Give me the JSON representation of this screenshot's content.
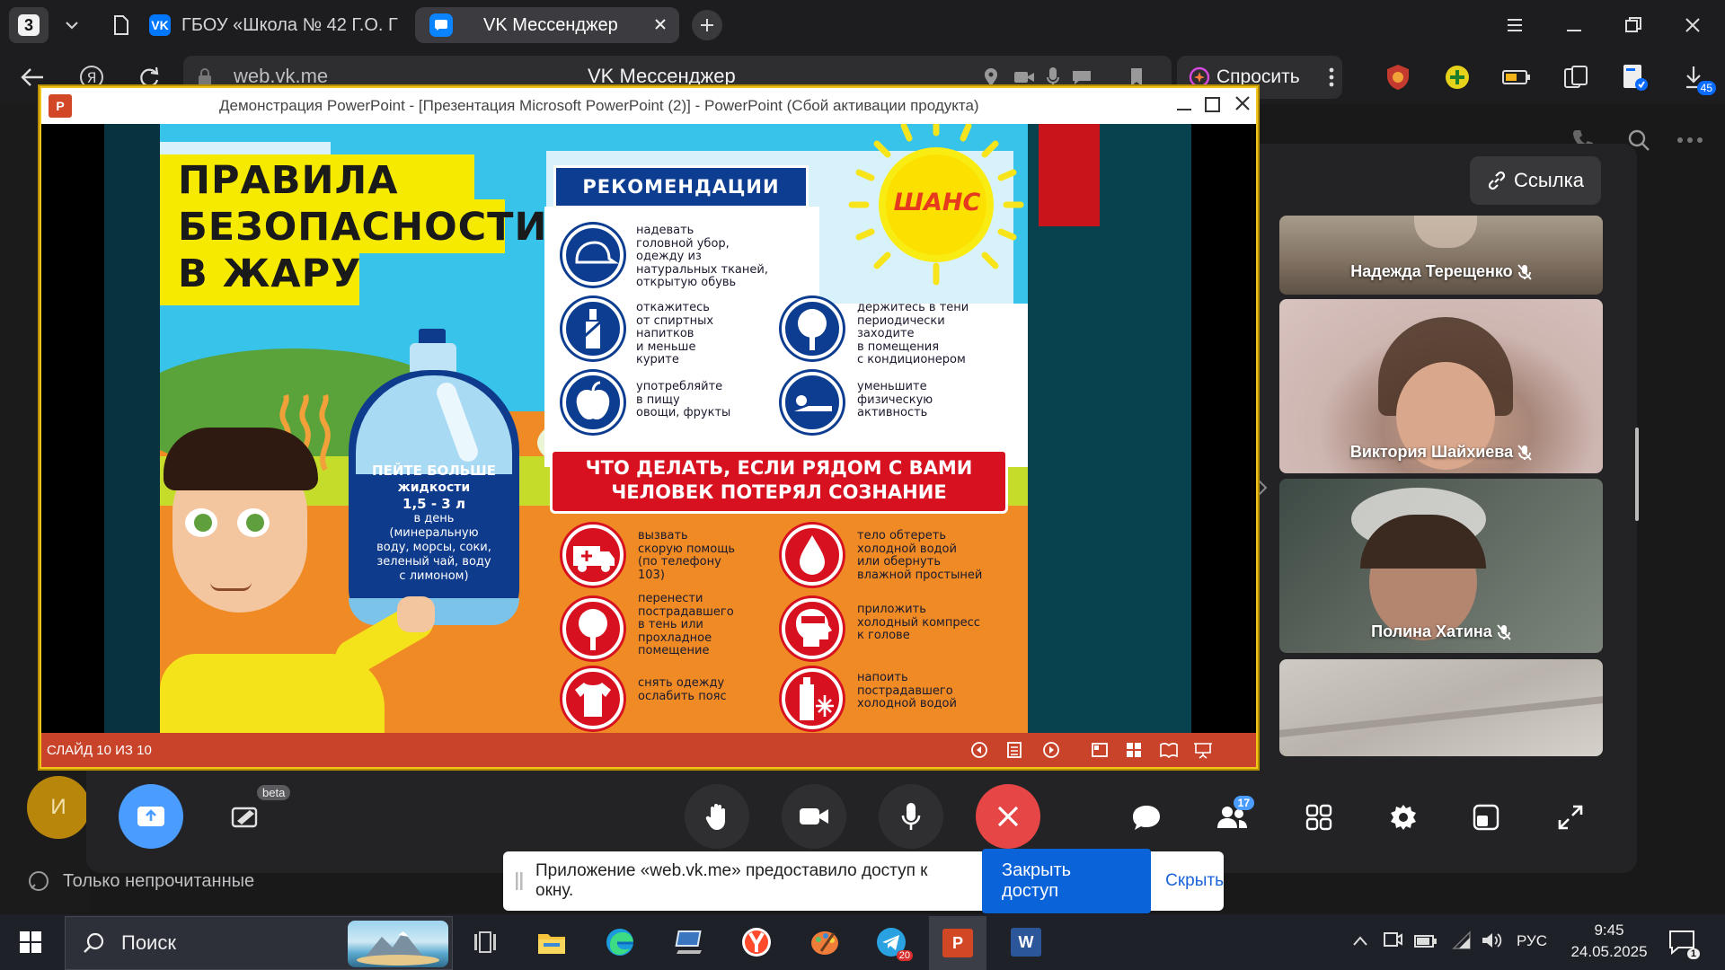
{
  "browser": {
    "tab_count": "3",
    "tabs": [
      {
        "title": "ГБОУ «Школа № 42 Г.О. Г",
        "active": false
      },
      {
        "title": "VK Мессенджер",
        "active": true
      }
    ],
    "address": "web.vk.me",
    "page_title": "VK Мессенджер",
    "ask_label": "Спросить",
    "downloads_badge": "45"
  },
  "vk": {
    "link_button": "Ссылка",
    "avatar_letter": "И",
    "filter_label": "Только непрочитанные",
    "participants_badge": "17",
    "beta_label": "beta"
  },
  "ppt": {
    "window_title": "Демонстрация PowerPoint - [Презентация Microsoft PowerPoint (2)] - PowerPoint (Сбой активации продукта)",
    "status": "СЛАЙД 10 ИЗ 10"
  },
  "slide": {
    "title_lines": [
      "ПРАВИЛА",
      "БЕЗОПАСНОСТИ",
      "В ЖАРУ"
    ],
    "logo": "ШАНС",
    "bottle_text": [
      "ПЕЙТЕ БОЛЬШЕ",
      "жидкости",
      "1,5 - 3 л",
      "в день",
      "(минеральную",
      "воду, морсы, соки,",
      "зеленый чай, воду",
      "с лимоном)"
    ],
    "rec_header": "РЕКОМЕНДАЦИИ",
    "recs_left": [
      "надевать\nголовной убор,\nодежду из\nнатуральных тканей,\nоткрытую обувь",
      "откажитесь\nот спиртных\nнапитков\nи меньше\nкурите",
      "употребляйте\nв пищу\nовощи, фрукты"
    ],
    "recs_right": [
      "держитесь в тени\nпериодически\nзаходите\nв помещения\nс кондиционером",
      "уменьшите\nфизическую\nактивность"
    ],
    "help_header_1": "ЧТО ДЕЛАТЬ, ЕСЛИ РЯДОМ С ВАМИ",
    "help_header_2": "ЧЕЛОВЕК ПОТЕРЯЛ СОЗНАНИЕ",
    "help_left": [
      "вызвать\nскорую помощь\n(по телефону\n103)",
      "перенести\nпострадавшего\nв тень или\nпрохладное\nпомещение",
      "снять одежду\nослабить пояс"
    ],
    "help_right": [
      "тело обтереть\nхолодной водой\nили обернуть\nвлажной простыней",
      "приложить\nхолодный компресс\nк голове",
      "напоить\nпострадавшего\nхолодной водой"
    ]
  },
  "participants": [
    {
      "name": "Надежда Терещенко"
    },
    {
      "name": "Виктория Шайхиева"
    },
    {
      "name": "Полина Хатина"
    }
  ],
  "share": {
    "message": "Приложение «web.vk.me» предоставило доступ к окну.",
    "stop_button": "Закрыть доступ",
    "hide_button": "Скрыть"
  },
  "taskbar": {
    "search": "Поиск",
    "lang": "РУС",
    "time": "9:45",
    "date": "24.05.2025",
    "telegram_badge": "20",
    "notif_count": "1"
  }
}
